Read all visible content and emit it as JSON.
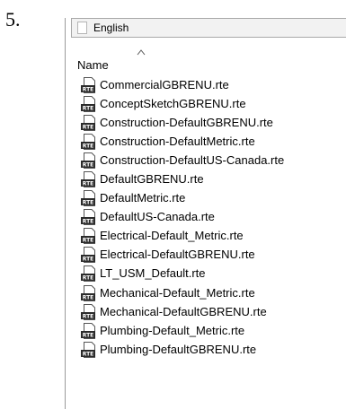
{
  "step_label": "5.",
  "path_bar": {
    "folder_name": "English"
  },
  "column": {
    "name_label": "Name"
  },
  "file_type_badge": "RTE",
  "files": [
    "CommercialGBRENU.rte",
    "ConceptSketchGBRENU.rte",
    "Construction-DefaultGBRENU.rte",
    "Construction-DefaultMetric.rte",
    "Construction-DefaultUS-Canada.rte",
    "DefaultGBRENU.rte",
    "DefaultMetric.rte",
    "DefaultUS-Canada.rte",
    "Electrical-Default_Metric.rte",
    "Electrical-DefaultGBRENU.rte",
    "LT_USM_Default.rte",
    "Mechanical-Default_Metric.rte",
    "Mechanical-DefaultGBRENU.rte",
    "Plumbing-Default_Metric.rte",
    "Plumbing-DefaultGBRENU.rte"
  ],
  "colors": {
    "icon_badge": "#2b2b2b",
    "icon_page": "#ffffff",
    "icon_outline": "#555555"
  }
}
